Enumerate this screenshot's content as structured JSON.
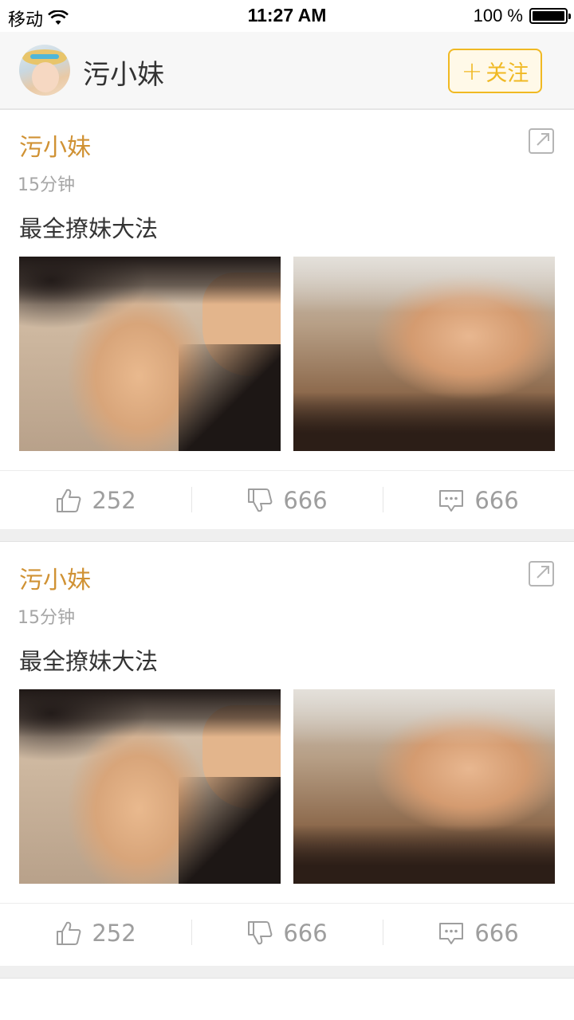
{
  "status_bar": {
    "carrier": "移动",
    "time": "11:27 AM",
    "battery": "100 %",
    "battery_level": 1.0
  },
  "header": {
    "title": "污小妹",
    "follow_plus": "+",
    "follow_label": "关注",
    "accent_color": "#f0b923"
  },
  "posts": [
    {
      "author": "污小妹",
      "time": "15分钟",
      "text": "最全撩妹大法",
      "likes": "252",
      "dislikes": "666",
      "comments": "666"
    },
    {
      "author": "污小妹",
      "time": "15分钟",
      "text": "最全撩妹大法",
      "likes": "252",
      "dislikes": "666",
      "comments": "666"
    }
  ],
  "icons": {
    "share": "share-external-icon",
    "like": "thumbs-up-icon",
    "dislike": "thumbs-down-icon",
    "comment": "comment-bubble-icon",
    "wifi": "wifi-icon",
    "battery": "battery-icon"
  }
}
